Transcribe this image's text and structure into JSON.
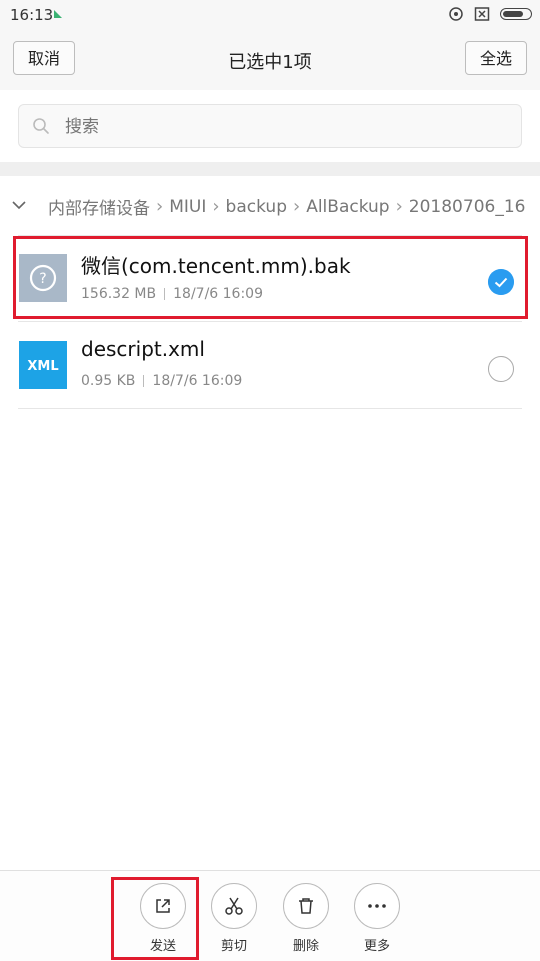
{
  "status_bar": {
    "time": "16:13"
  },
  "header": {
    "cancel_label": "取消",
    "title": "已选中1项",
    "select_all_label": "全选"
  },
  "search": {
    "placeholder": "搜索"
  },
  "breadcrumb": {
    "items": [
      "内部存储设备",
      "MIUI",
      "backup",
      "AllBackup",
      "20180706_16"
    ]
  },
  "files": [
    {
      "name": "微信(com.tencent.mm).bak",
      "size": "156.32 MB",
      "date": "18/7/6 16:09",
      "icon": "unknown-file-icon",
      "selected": true
    },
    {
      "name": "descript.xml",
      "size": "0.95 KB",
      "date": "18/7/6 16:09",
      "icon": "xml-file-icon",
      "icon_text": "XML",
      "selected": false
    }
  ],
  "actions": [
    {
      "label": "发送",
      "icon": "share-icon"
    },
    {
      "label": "剪切",
      "icon": "scissors-icon"
    },
    {
      "label": "删除",
      "icon": "trash-icon"
    },
    {
      "label": "更多",
      "icon": "more-icon"
    }
  ],
  "colors": {
    "accent": "#2a9cf0",
    "highlight": "#e01b2e",
    "xml_icon": "#1da3e6",
    "unknown_icon": "#a9b8c8"
  }
}
